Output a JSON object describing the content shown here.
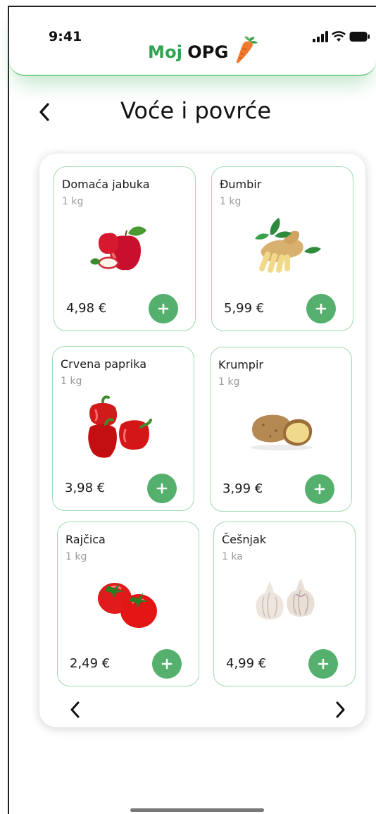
{
  "status_bar": {
    "time": "9:41"
  },
  "brand": {
    "part1": "Moj",
    "part2": "OPG",
    "accent_color": "#2ea44f"
  },
  "page": {
    "title": "Voće i povrće"
  },
  "icons": {
    "back": "chevron-left-icon",
    "prev": "chevron-left-icon",
    "next": "chevron-right-icon",
    "add": "plus-icon"
  },
  "products": [
    {
      "name": "Domaća jabuka",
      "unit": "1 kg",
      "price": "4,98 €",
      "image": "apple-image"
    },
    {
      "name": "Đumbir",
      "unit": "1 kg",
      "price": "5,99 €",
      "image": "ginger-image"
    },
    {
      "name": "Crvena paprika",
      "unit": "1 kg",
      "price": "3,98 €",
      "image": "red-pepper-image"
    },
    {
      "name": "Krumpir",
      "unit": "1 kg",
      "price": "3,99 €",
      "image": "potato-image"
    },
    {
      "name": "Rajčica",
      "unit": "1 kg",
      "price": "2,49 €",
      "image": "tomato-image"
    },
    {
      "name": "Češnjak",
      "unit": "1 ka",
      "price": "4,99 €",
      "image": "garlic-image"
    }
  ]
}
